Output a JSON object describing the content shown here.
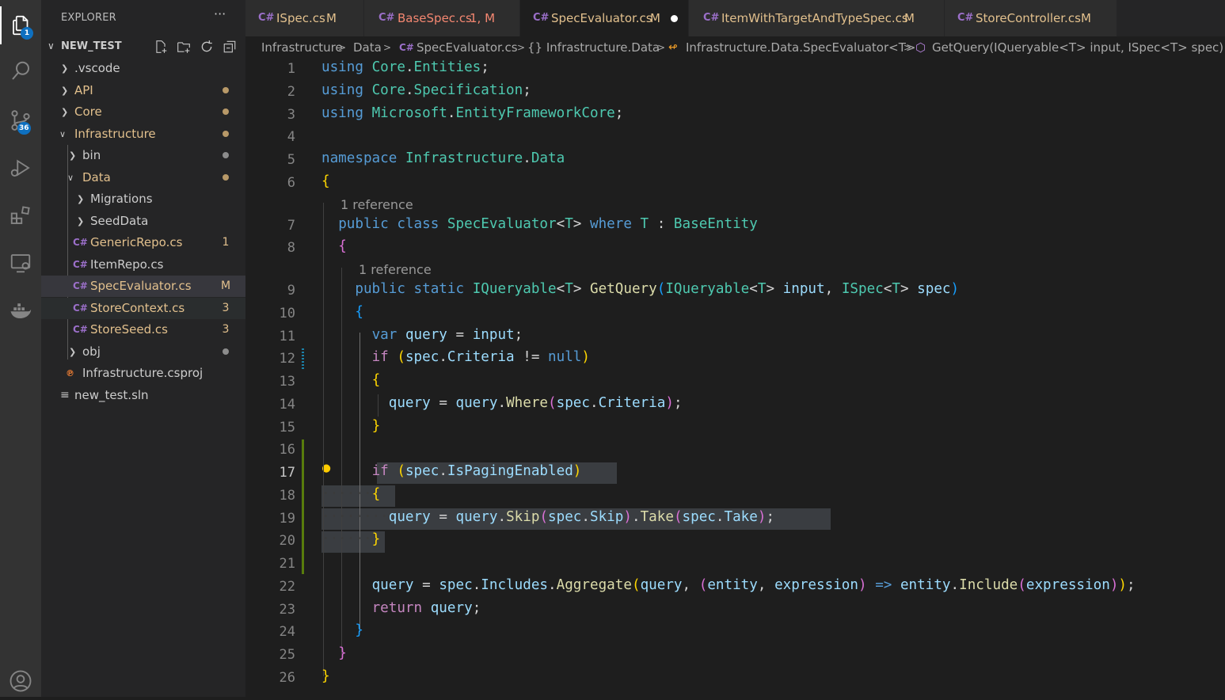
{
  "activity_bar": {
    "explorer_badge": "1",
    "scm_badge": "36"
  },
  "explorer": {
    "title": "EXPLORER",
    "more": "···",
    "workspace": "NEW_TEST",
    "tree": [
      {
        "label": ".vscode",
        "kind": "folder"
      },
      {
        "label": "API",
        "kind": "folder",
        "decoration": "dot"
      },
      {
        "label": "Core",
        "kind": "folder",
        "decoration": "dot"
      },
      {
        "label": "Infrastructure",
        "kind": "folder",
        "decoration": "dot"
      },
      {
        "label": "bin",
        "kind": "folder",
        "decoration": "dot"
      },
      {
        "label": "Data",
        "kind": "folder",
        "decoration": "dot"
      },
      {
        "label": "Migrations",
        "kind": "folder"
      },
      {
        "label": "SeedData",
        "kind": "folder"
      },
      {
        "label": "GenericRepo.cs",
        "kind": "cs",
        "decoration": "1"
      },
      {
        "label": "ItemRepo.cs",
        "kind": "cs"
      },
      {
        "label": "SpecEvaluator.cs",
        "kind": "cs",
        "decoration": "M"
      },
      {
        "label": "StoreContext.cs",
        "kind": "cs",
        "decoration": "3"
      },
      {
        "label": "StoreSeed.cs",
        "kind": "cs",
        "decoration": "3"
      },
      {
        "label": "obj",
        "kind": "folder",
        "decoration": "dot"
      },
      {
        "label": "Infrastructure.csproj",
        "kind": "rss"
      },
      {
        "label": "new_test.sln",
        "kind": "sln"
      }
    ]
  },
  "tabs": [
    {
      "label": "ISpec.cs",
      "status": "M"
    },
    {
      "label": "BaseSpec.cs",
      "status": "1, M"
    },
    {
      "label": "SpecEvaluator.cs",
      "status": "M"
    },
    {
      "label": "ItemWithTargetAndTypeSpec.cs",
      "status": "M"
    },
    {
      "label": "StoreController.cs",
      "status": "M"
    }
  ],
  "breadcrumb": {
    "parts": [
      "Infrastructure",
      "Data",
      "SpecEvaluator.cs",
      "{} Infrastructure.Data",
      "Infrastructure.Data.SpecEvaluator<T>",
      "GetQuery(IQueryable<T> input, ISpec<T> spec)"
    ],
    "sep": ">"
  },
  "editor": {
    "line_numbers": [
      "1",
      "2",
      "3",
      "4",
      "5",
      "6",
      "7",
      "8",
      "9",
      "10",
      "11",
      "12",
      "13",
      "14",
      "15",
      "16",
      "17",
      "18",
      "19",
      "20",
      "21",
      "22",
      "23",
      "24",
      "25",
      "26"
    ],
    "current_line": "17",
    "code_lens": [
      "1 reference",
      "1 reference"
    ],
    "lines": [
      "using Core.Entities;",
      "using Core.Specification;",
      "using Microsoft.EntityFrameworkCore;",
      "",
      "namespace Infrastructure.Data",
      "{",
      "  public class SpecEvaluator<T> where T : BaseEntity",
      "  {",
      "    public static IQueryable<T> GetQuery(IQueryable<T> input, ISpec<T> spec)",
      "    {",
      "      var query = input;",
      "      if (spec.Criteria != null)",
      "      {",
      "        query = query.Where(spec.Criteria);",
      "      }",
      "",
      "      if (spec.IsPagingEnabled)",
      "      {",
      "        query = query.Skip(spec.Skip).Take(spec.Take);",
      "      }",
      "",
      "      query = spec.Includes.Aggregate(query, (entity, expression) => entity.Include(expression));",
      "      return query;",
      "    }",
      "  }",
      "}"
    ]
  },
  "colors": {
    "keyword": "#569cd6",
    "control": "#c586c0",
    "type": "#4ec9b0",
    "function": "#dcdcaa",
    "variable": "#9cdcfe",
    "folder_modified": "#e2c08d",
    "file_error": "#f48771",
    "tab_modified": "#e2c08d"
  }
}
